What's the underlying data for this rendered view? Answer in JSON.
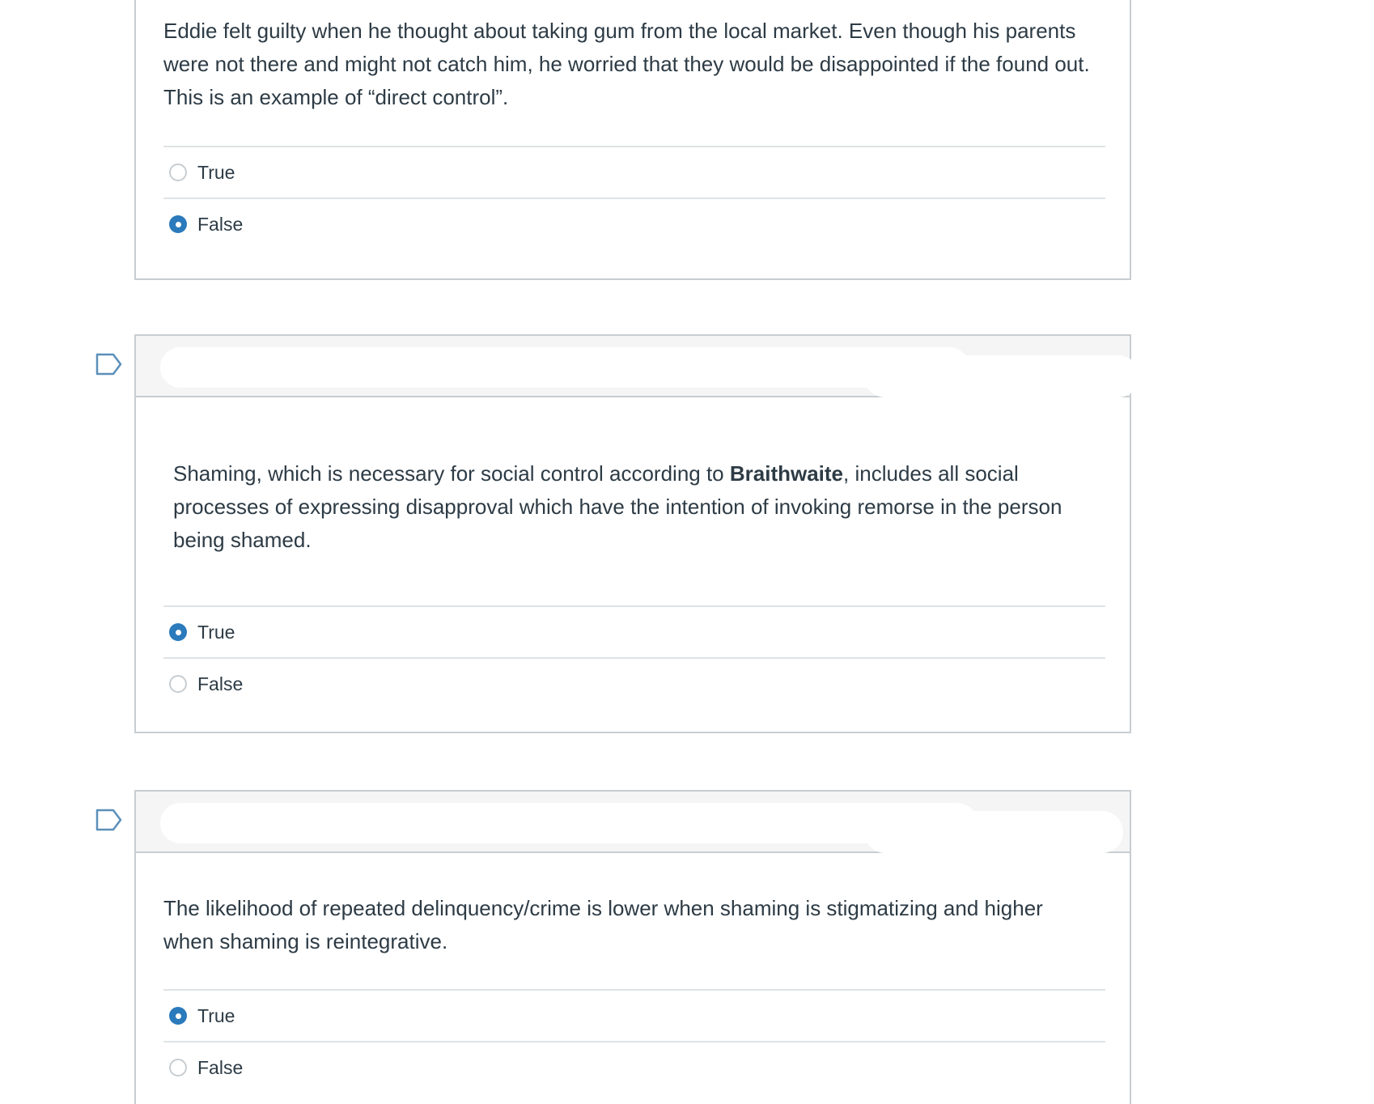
{
  "colors": {
    "accent": "#2b7abc",
    "border": "#c7cdd1",
    "divider": "#dfe3e5",
    "header_bg": "#f5f5f5",
    "text": "#2d3b45",
    "flag": "#5b8fb9"
  },
  "questions": [
    {
      "text": "Eddie felt guilty when he thought about taking gum from the local market. Even though his parents were not there and might not catch him, he worried that they would be disappointed if the found out. This is an example of “direct control”.",
      "answers": [
        {
          "label": "True",
          "selected": false
        },
        {
          "label": "False",
          "selected": true
        }
      ]
    },
    {
      "flag_icon": "flag-bookmark-icon",
      "text_before": "Shaming, which is necessary for social control according to ",
      "text_bold": "Braithwaite",
      "text_after": ", includes all social processes of expressing disapproval which have the intention of invoking remorse in the person being shamed.",
      "answers": [
        {
          "label": "True",
          "selected": true
        },
        {
          "label": "False",
          "selected": false
        }
      ]
    },
    {
      "flag_icon": "flag-bookmark-icon",
      "text": "The likelihood of repeated delinquency/crime is lower when shaming is stigmatizing and higher when shaming is reintegrative.",
      "answers": [
        {
          "label": "True",
          "selected": true
        },
        {
          "label": "False",
          "selected": false
        }
      ]
    }
  ]
}
